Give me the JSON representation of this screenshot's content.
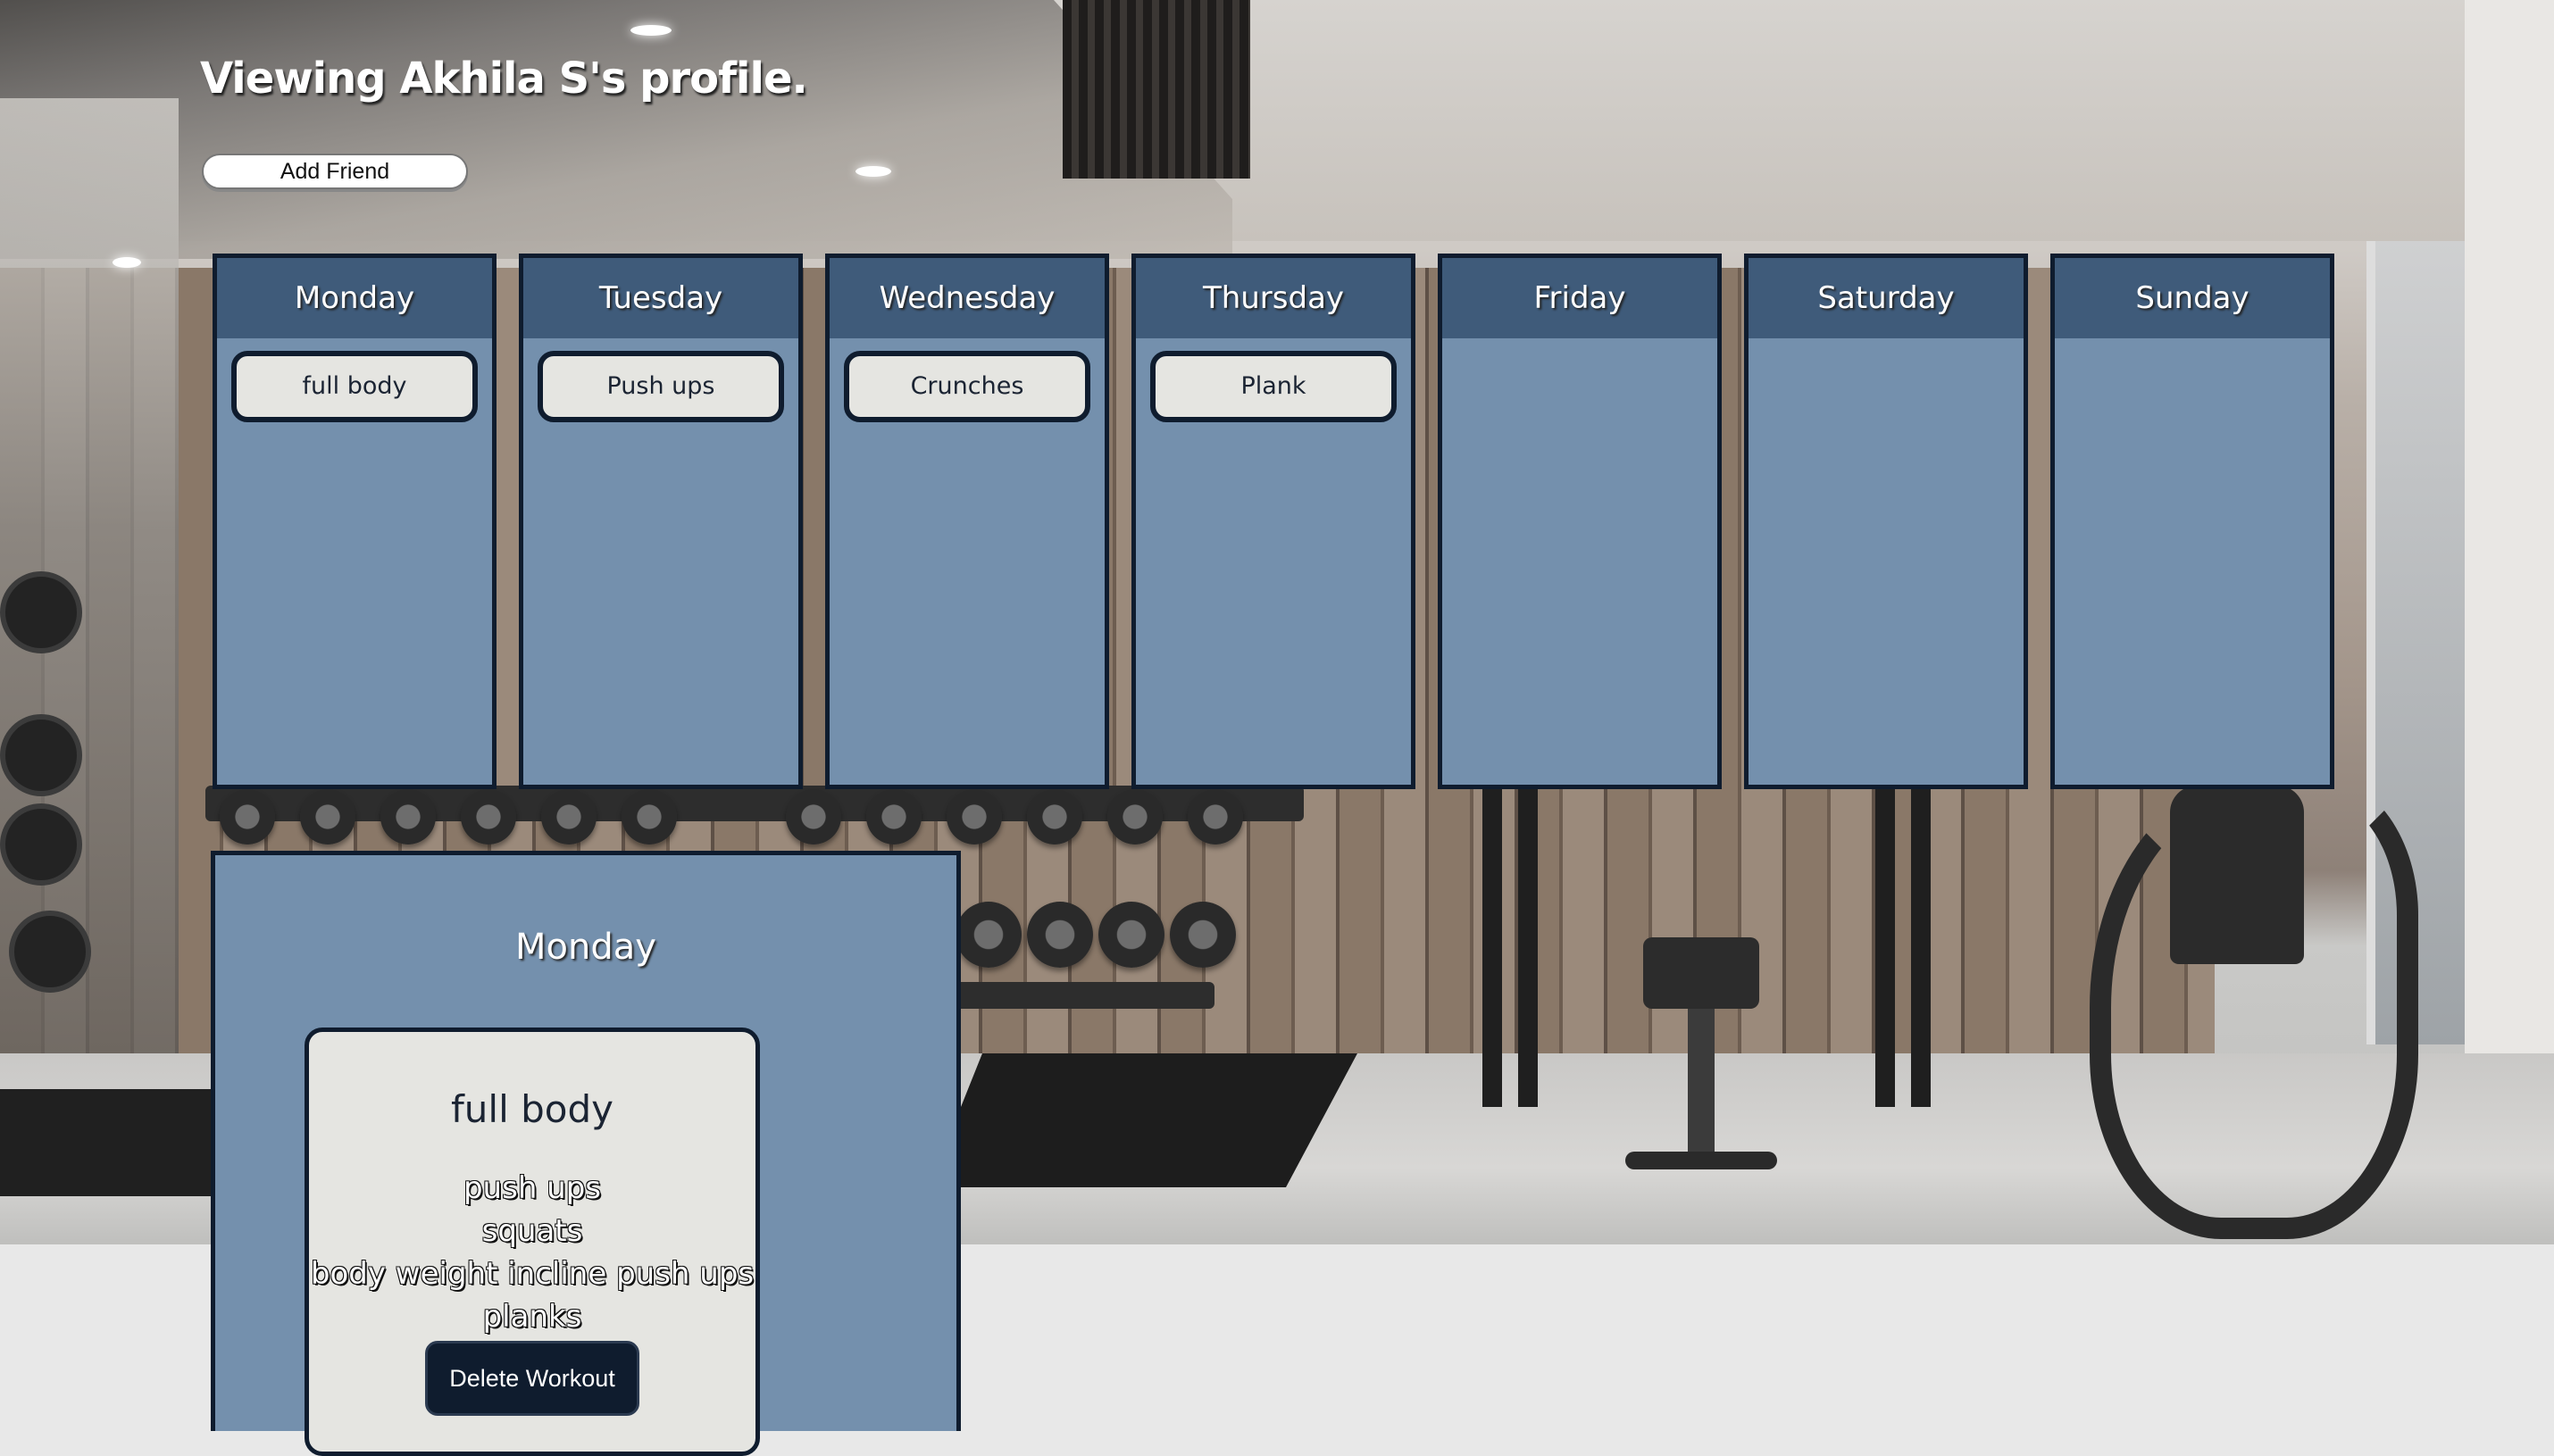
{
  "profile": {
    "title": "Viewing Akhila S's profile."
  },
  "actions": {
    "add_friend_label": "Add Friend"
  },
  "week": [
    {
      "day": "Monday",
      "workouts": [
        "full body"
      ]
    },
    {
      "day": "Tuesday",
      "workouts": [
        "Push ups"
      ]
    },
    {
      "day": "Wednesday",
      "workouts": [
        "Crunches"
      ]
    },
    {
      "day": "Thursday",
      "workouts": [
        "Plank"
      ]
    },
    {
      "day": "Friday",
      "workouts": []
    },
    {
      "day": "Saturday",
      "workouts": []
    },
    {
      "day": "Sunday",
      "workouts": []
    }
  ],
  "detail": {
    "day": "Monday",
    "workout": {
      "name": "full body",
      "exercises": [
        "push ups",
        "squats",
        "body weight incline push ups",
        "planks"
      ],
      "delete_label": "Delete Workout"
    }
  },
  "colors": {
    "panel": "#7490ad",
    "header": "#3f5b7a",
    "border": "#0f1c2e",
    "card": "#e5e5e1",
    "page_bg": "#e8e8e8"
  }
}
